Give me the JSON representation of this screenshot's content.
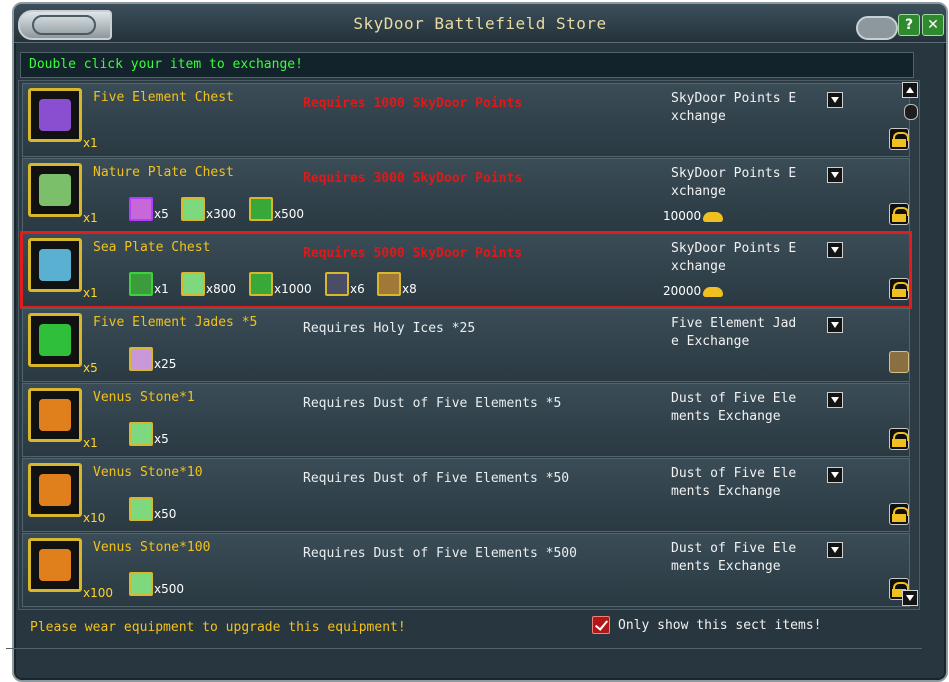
{
  "window": {
    "title": "SkyDoor Battlefield Store"
  },
  "hint": "Double click your item to exchange!",
  "rows": [
    {
      "name": "Five Element Chest",
      "qty": "x1",
      "requirement": "Requires 1000 SkyDoor Points",
      "req_style": "red",
      "materials": [],
      "exchange": [
        "SkyDoor Points E",
        "xchange"
      ],
      "cost": "",
      "action_icon": "lock-icon",
      "icon_color": "#8a4fd0"
    },
    {
      "name": "Nature Plate Chest",
      "qty": "x1",
      "requirement": "Requires 3000 SkyDoor Points",
      "req_style": "red",
      "materials": [
        {
          "qty": "x5",
          "color": "#c868d8",
          "frame": "purple"
        },
        {
          "qty": "x300",
          "color": "#7ed87e",
          "frame": "gold"
        },
        {
          "qty": "x500",
          "color": "#38a838",
          "frame": "gold"
        }
      ],
      "exchange": [
        "SkyDoor Points E",
        "xchange"
      ],
      "cost": "10000",
      "action_icon": "lock-icon",
      "icon_color": "#7bbf6a"
    },
    {
      "name": "Sea Plate Chest",
      "qty": "x1",
      "requirement": "Requires 5000 SkyDoor Points",
      "req_style": "red",
      "materials": [
        {
          "qty": "x1",
          "color": "#3c9c3c",
          "frame": "green"
        },
        {
          "qty": "x800",
          "color": "#7ed87e",
          "frame": "gold"
        },
        {
          "qty": "x1000",
          "color": "#38a838",
          "frame": "gold"
        },
        {
          "qty": "x6",
          "color": "#4a4e64",
          "frame": "gold"
        },
        {
          "qty": "x8",
          "color": "#a07838",
          "frame": "gold"
        }
      ],
      "exchange": [
        "SkyDoor Points E",
        "xchange"
      ],
      "cost": "20000",
      "action_icon": "lock-icon",
      "icon_color": "#5ab0d0"
    },
    {
      "name": "Five Element Jades *5",
      "qty": "x5",
      "requirement": "Requires Holy Ices *25",
      "req_style": "white",
      "materials": [
        {
          "qty": "x25",
          "color": "#c898d8",
          "frame": "gold"
        }
      ],
      "exchange": [
        "Five Element Jad",
        "e Exchange"
      ],
      "cost": "",
      "action_icon": "scroll-icon",
      "icon_color": "#2fbf3a"
    },
    {
      "name": "Venus Stone*1",
      "qty": "x1",
      "requirement": "Requires Dust of Five Elements *5",
      "req_style": "white",
      "materials": [
        {
          "qty": "x5",
          "color": "#7ed87e",
          "frame": "gold"
        }
      ],
      "exchange": [
        "Dust of Five Ele",
        "ments Exchange"
      ],
      "cost": "",
      "action_icon": "lock-icon",
      "icon_color": "#e0801c"
    },
    {
      "name": "Venus Stone*10",
      "qty": "x10",
      "requirement": "Requires Dust of Five Elements *50",
      "req_style": "white",
      "materials": [
        {
          "qty": "x50",
          "color": "#7ed87e",
          "frame": "gold"
        }
      ],
      "exchange": [
        "Dust of Five Ele",
        "ments Exchange"
      ],
      "cost": "",
      "action_icon": "lock-icon",
      "icon_color": "#e0801c"
    },
    {
      "name": "Venus Stone*100",
      "qty": "x100",
      "requirement": "Requires Dust of Five Elements *500",
      "req_style": "white",
      "materials": [
        {
          "qty": "x500",
          "color": "#7ed87e",
          "frame": "gold"
        }
      ],
      "exchange": [
        "Dust of Five Ele",
        "ments Exchange"
      ],
      "cost": "",
      "action_icon": "lock-icon",
      "icon_color": "#e0801c"
    }
  ],
  "footer": {
    "message": "Please wear equipment to upgrade this equipment!",
    "checkbox_label": "Only show this sect items!",
    "checkbox_checked": true
  },
  "colors": {
    "accent_gold": "#f2c21c",
    "hint_green": "#38ff38",
    "requirement_red": "#e01818",
    "selection": "#e01c1c"
  }
}
